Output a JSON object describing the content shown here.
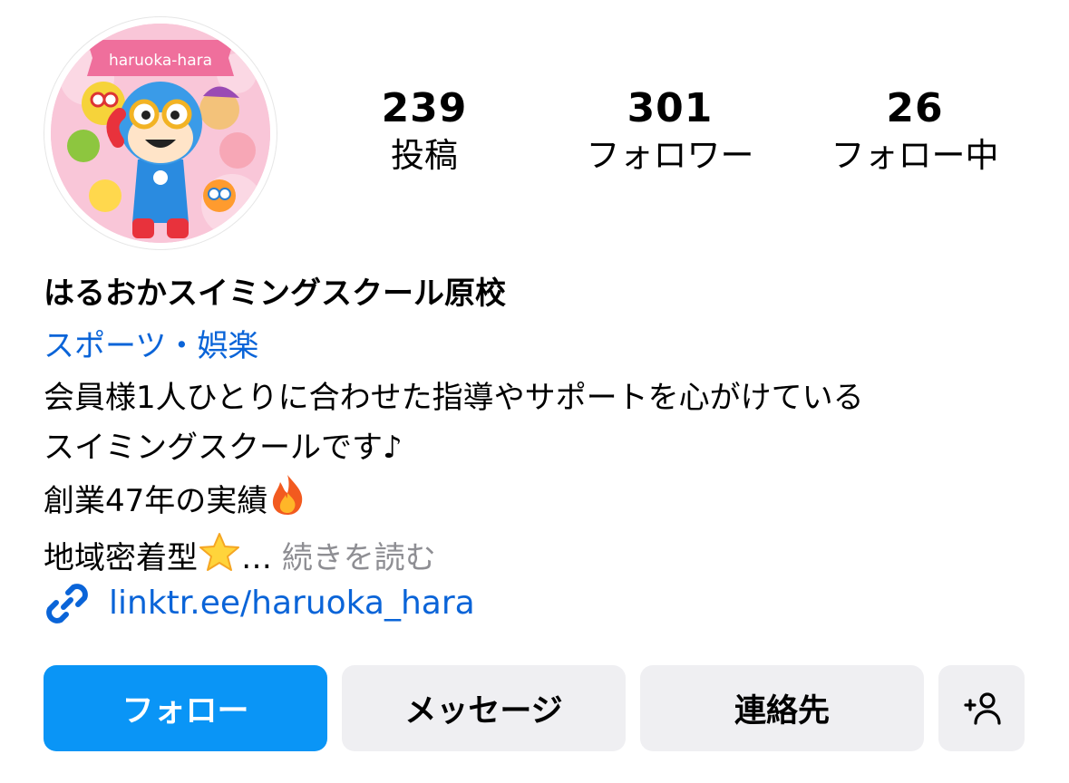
{
  "profile": {
    "avatar_banner": "haruoka-hara",
    "stats": {
      "posts_count": "239",
      "posts_label": "投稿",
      "followers_count": "301",
      "followers_label": "フォロワー",
      "following_count": "26",
      "following_label": "フォロー中"
    },
    "display_name": "はるおかスイミングスクール原校",
    "category": "スポーツ・娯楽",
    "bio": {
      "line1": "会員様1人ひとりに合わせた指導やサポートを心がけている",
      "line2": "スイミングスクールです♪",
      "line3": "創業47年の実績",
      "line3_emoji": "fire-emoji",
      "line4": "地域密着型",
      "line4_emoji": "star-emoji",
      "ellipsis": "…",
      "more_label": "続きを読む"
    },
    "link": {
      "icon": "link-icon",
      "text": "linktr.ee/haruoka_hara"
    }
  },
  "actions": {
    "follow_label": "フォロー",
    "message_label": "メッセージ",
    "contact_label": "連絡先",
    "add_user_icon": "add-person-icon"
  },
  "colors": {
    "follow_button": "#0a95f6",
    "secondary_button": "#efeff2",
    "link_blue": "#0a64d8",
    "muted_text": "#8e8e93"
  }
}
